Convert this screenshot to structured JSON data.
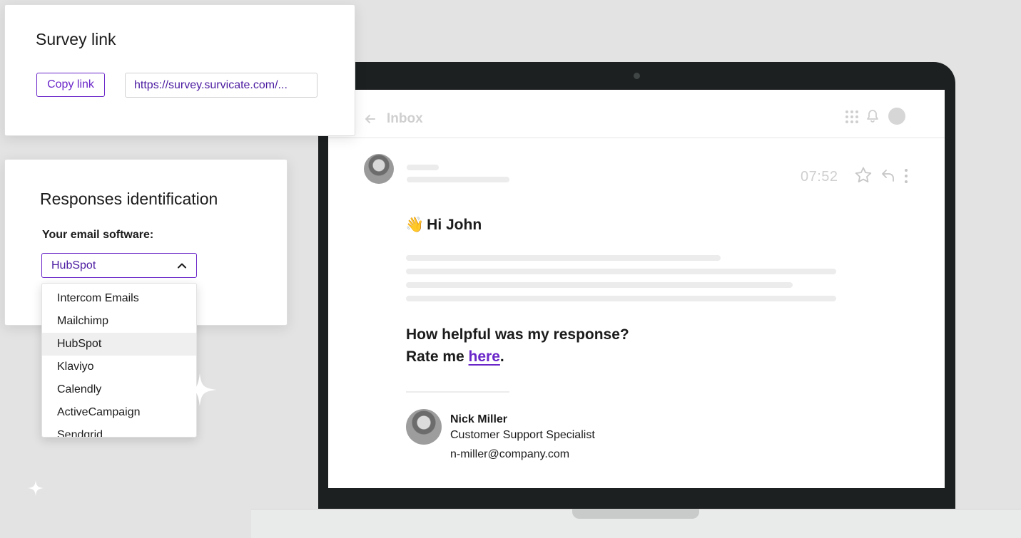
{
  "survey_link": {
    "title": "Survey link",
    "copy_button": "Copy link",
    "url": "https://survey.survicate.com/..."
  },
  "responses": {
    "title": "Responses identification",
    "label": "Your email software:",
    "selected": "HubSpot",
    "options": [
      "Intercom Emails",
      "Mailchimp",
      "HubSpot",
      "Klaviyo",
      "Calendly",
      "ActiveCampaign",
      "Sendgrid"
    ]
  },
  "email": {
    "header_title": "Inbox",
    "time": "07:52",
    "greeting_emoji": "👋",
    "greeting": "Hi John",
    "question_line1": "How helpful was my response?",
    "question_line2_prefix": "Rate me ",
    "link_text": "here",
    "question_line2_suffix": ".",
    "signature": {
      "name": "Nick Miller",
      "role": "Customer Support Specialist",
      "email": "n-miller@company.com"
    }
  },
  "colors": {
    "accent": "#6a26c9",
    "background": "#e3e3e3",
    "laptop_frame": "#1c2020"
  },
  "icons": [
    "arrow-left-icon",
    "apps-grid-icon",
    "bell-icon",
    "star-icon",
    "reply-icon",
    "more-vertical-icon",
    "chevron-up-icon",
    "sparkle-icon"
  ]
}
